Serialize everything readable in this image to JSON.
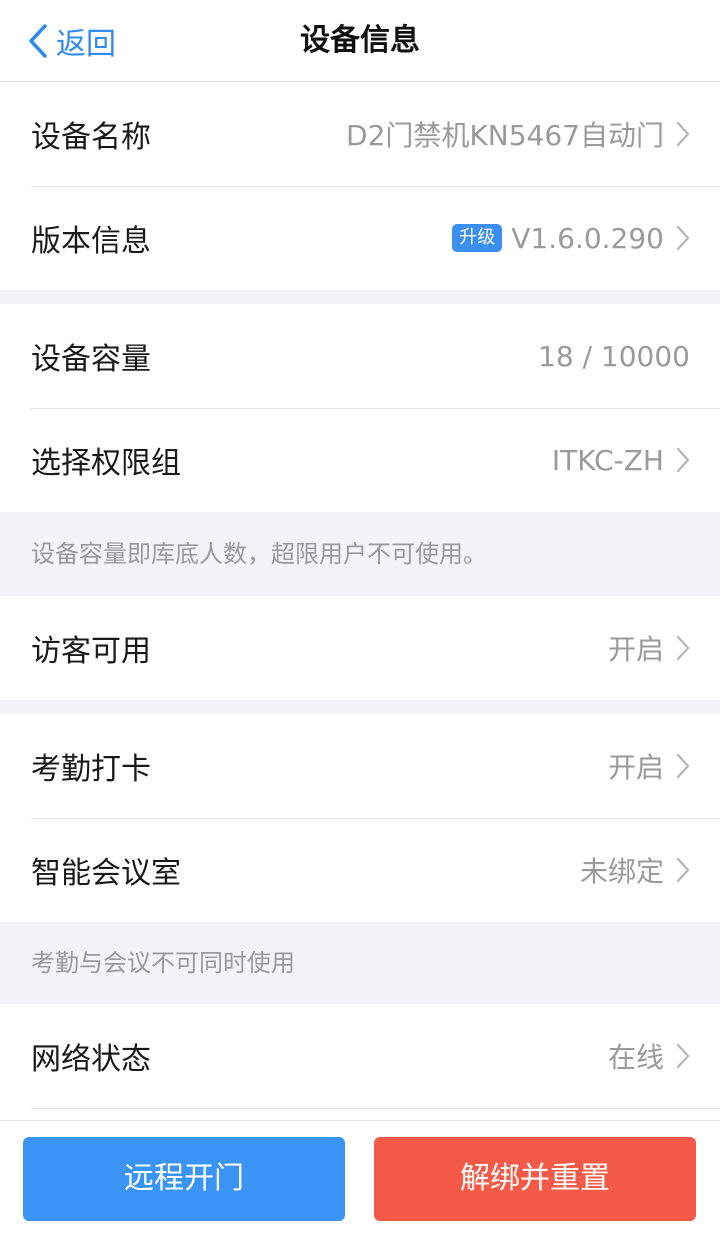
{
  "nav": {
    "back_label": "返回",
    "title": "设备信息"
  },
  "rows": {
    "device_name": {
      "label": "设备名称",
      "value": "D2门禁机KN5467自动门"
    },
    "version": {
      "label": "版本信息",
      "badge": "升级",
      "value": "V1.6.0.290"
    },
    "capacity": {
      "label": "设备容量",
      "value": "18 / 10000"
    },
    "permission_group": {
      "label": "选择权限组",
      "value": "ITKC-ZH"
    },
    "visitor": {
      "label": "访客可用",
      "value": "开启"
    },
    "attendance": {
      "label": "考勤打卡",
      "value": "开启"
    },
    "meeting_room": {
      "label": "智能会议室",
      "value": "未绑定"
    },
    "network": {
      "label": "网络状态",
      "value": "在线"
    }
  },
  "notes": {
    "capacity_note": "设备容量即库底人数，超限用户不可使用。",
    "attendance_note": "考勤与会议不可同时使用"
  },
  "footer": {
    "open_door": "远程开门",
    "unbind_reset": "解绑并重置"
  },
  "colors": {
    "accent_blue": "#3a94f5",
    "danger_red": "#f45a47",
    "back_blue": "#2e8bf0"
  },
  "icons": {
    "back": "chevron-left-icon",
    "row_arrow": "chevron-right-icon"
  }
}
